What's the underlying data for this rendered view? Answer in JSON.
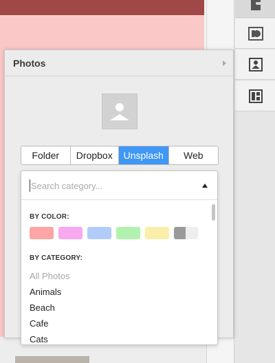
{
  "panel": {
    "title": "Photos"
  },
  "source_tabs": [
    {
      "label": "Folder",
      "active": false
    },
    {
      "label": "Dropbox",
      "active": false
    },
    {
      "label": "Unsplash",
      "active": true
    },
    {
      "label": "Web",
      "active": false
    }
  ],
  "category_dropdown": {
    "placeholder": "Search category...",
    "value": "",
    "by_color_label": "BY COLOR:",
    "colors": [
      "#fca5a5",
      "#f7a8ee",
      "#b2ccfa",
      "#b1f2ae",
      "#fbeea8",
      "#9a9a9a"
    ],
    "by_category_label": "BY CATEGORY:",
    "categories": [
      "All Photos",
      "Animals",
      "Beach",
      "Cafe",
      "Cats"
    ]
  },
  "toolbar": {
    "icons": [
      "partial-tool-icon",
      "double-d-icon",
      "image-placeholder-icon",
      "layout-icon"
    ]
  },
  "accent": "#3f97f6"
}
